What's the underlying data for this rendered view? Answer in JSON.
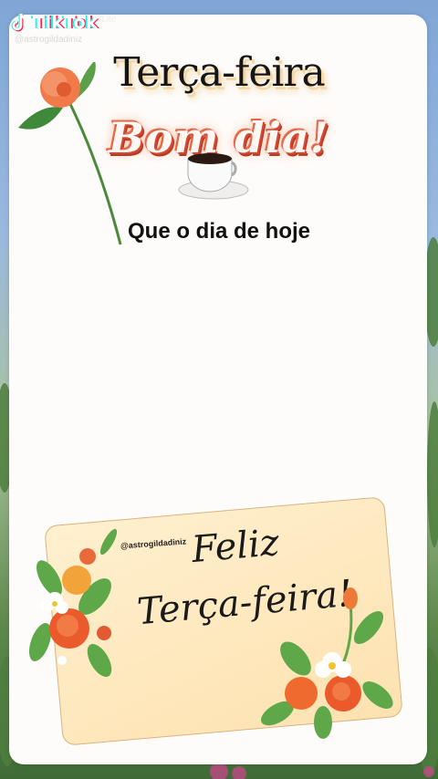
{
  "watermark": {
    "brand": "TikTok",
    "tier": "Lite",
    "handle": "@astrogildadiniz"
  },
  "card": {
    "title": "Terça-feira",
    "greeting": "Bom dia!",
    "subtitle": "Que o dia de hoje"
  },
  "note": {
    "handle": "@astrogildadiniz",
    "line1": "Feliz",
    "line2": "Terça-feira!"
  },
  "colors": {
    "card": "#fefcfb",
    "note": "#fde2b0",
    "accent": "#d14a36",
    "sky": "#7fa6d6"
  },
  "icons": [
    "tiktok-logo-icon",
    "rose-icon",
    "coffee-cup-icon",
    "flower-bouquet-icon"
  ]
}
